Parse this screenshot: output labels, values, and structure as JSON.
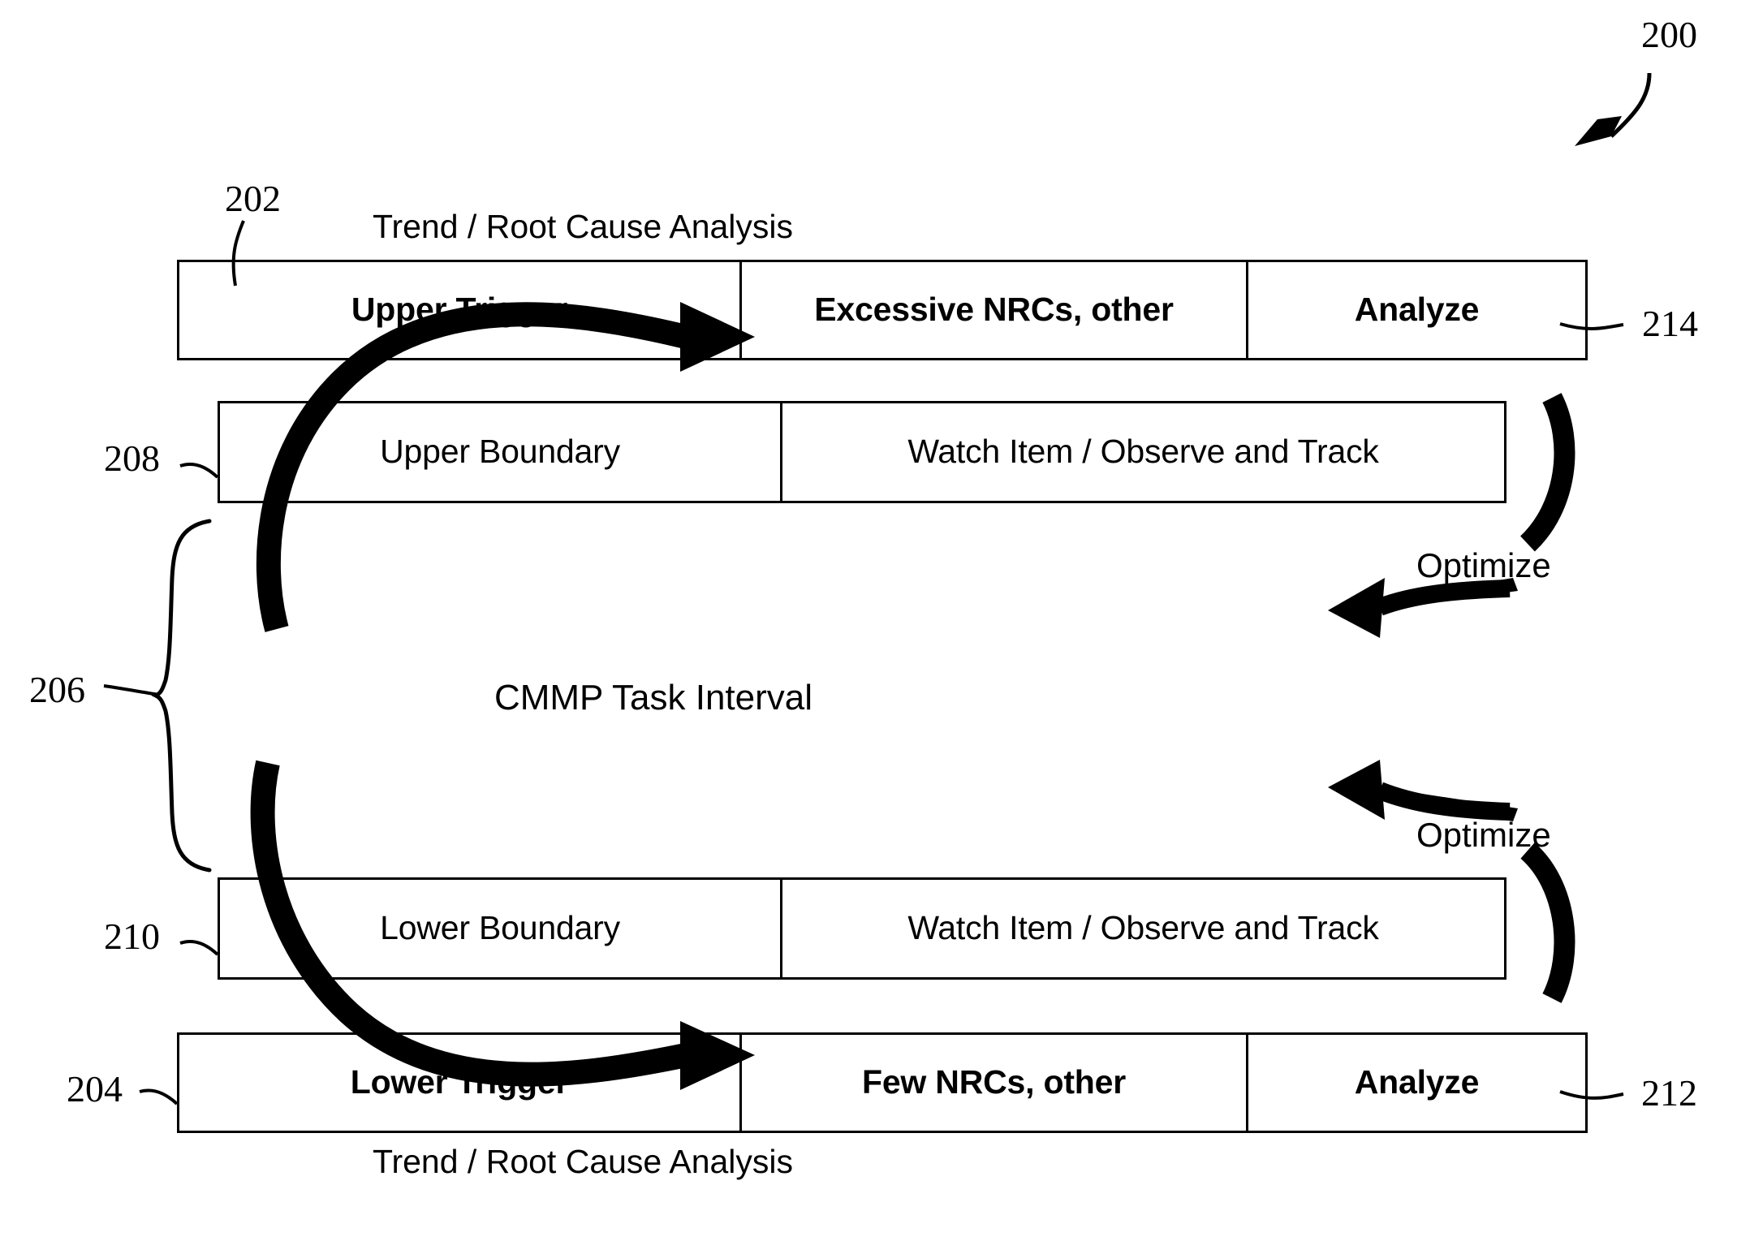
{
  "figure": {
    "label": "200",
    "title_caption_top": "Trend / Root Cause Analysis",
    "title_caption_bottom": "Trend / Root Cause Analysis",
    "center_label": "CMMP Task Interval"
  },
  "reference_numerals": {
    "figure": "200",
    "upper_trigger_row": "202",
    "lower_trigger_row": "204",
    "task_interval_brace": "206",
    "upper_boundary_row": "208",
    "lower_boundary_row": "210",
    "lower_analyze": "212",
    "upper_analyze": "214"
  },
  "rows": {
    "upper_trigger": {
      "ref": "202",
      "right_ref": "214",
      "caption": "Trend / Root Cause Analysis",
      "cells": [
        {
          "text": "Upper Trigger",
          "bold": true
        },
        {
          "text": "Excessive NRCs, other",
          "bold": true
        },
        {
          "text": "Analyze",
          "bold": true
        }
      ]
    },
    "upper_boundary": {
      "ref": "208",
      "cells": [
        {
          "text": "Upper Boundary",
          "bold": false
        },
        {
          "text": "Watch Item / Observe and Track",
          "bold": false
        }
      ]
    },
    "lower_boundary": {
      "ref": "210",
      "cells": [
        {
          "text": "Lower Boundary",
          "bold": false
        },
        {
          "text": "Watch Item / Observe and Track",
          "bold": false
        }
      ]
    },
    "lower_trigger": {
      "ref": "204",
      "right_ref": "212",
      "caption": "Trend / Root Cause Analysis",
      "cells": [
        {
          "text": "Lower Trigger",
          "bold": true
        },
        {
          "text": "Few NRCs, other",
          "bold": true
        },
        {
          "text": "Analyze",
          "bold": true
        }
      ]
    }
  },
  "annotations": {
    "optimize_upper": "Optimize",
    "optimize_lower": "Optimize"
  },
  "colors": {
    "stroke": "#000000",
    "background": "#ffffff"
  }
}
